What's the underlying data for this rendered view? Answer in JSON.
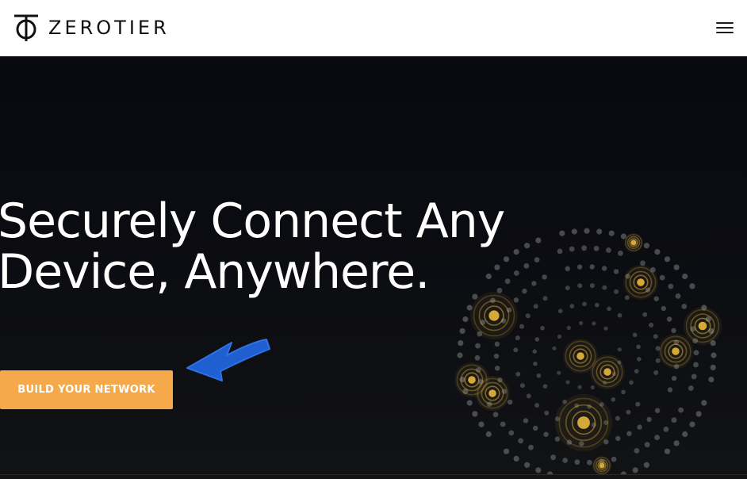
{
  "header": {
    "brand_name": "ZEROTIER",
    "logo_icon": "zerotier-logo-icon",
    "menu_icon": "hamburger-menu-icon"
  },
  "hero": {
    "headline_line1": "Securely Connect Any",
    "headline_line2": "Device, Anywhere.",
    "cta_label": "BUILD YOUR NETWORK",
    "annotation_icon": "blue-arrow-icon",
    "graphic_icon": "dotted-globe-network-graphic"
  },
  "colors": {
    "hero_background": "#0c0d10",
    "cta_background": "#f6a94a",
    "header_background": "#ffffff",
    "annotation_arrow": "#1f5fd0",
    "node_gold": "#d4a93a",
    "dot_gray": "#7a7f87"
  }
}
